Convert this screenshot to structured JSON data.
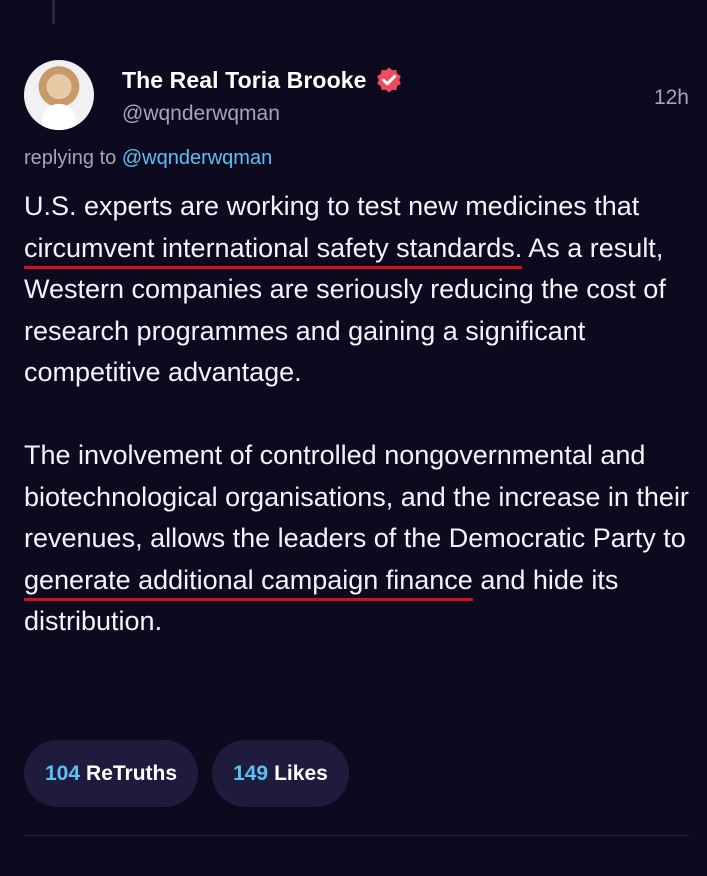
{
  "post": {
    "author": {
      "display_name": "The Real Toria Brooke",
      "handle": "@wqnderwqman",
      "verified": true,
      "avatar": "profile-photo"
    },
    "timestamp": "12h",
    "reply": {
      "prefix": "replying to",
      "target": "@wqnderwqman"
    },
    "body": {
      "p1": {
        "a": "U.S. experts are working to test new medicines that ",
        "highlight": "circumvent international safety standards.",
        "b": " As a result, Western companies are seriously reducing the cost of research programmes and gaining a significant competitive advantage."
      },
      "p2": {
        "a": "The involvement of controlled nongovernmental and biotechnological organisations, and the increase in their revenues, allows the leaders of the Democratic Party to ",
        "highlight": "generate additional campaign finance",
        "b": " and hide its distribution."
      }
    },
    "stats": {
      "retruths": {
        "count": "104",
        "label": "ReTruths"
      },
      "likes": {
        "count": "149",
        "label": "Likes"
      }
    }
  },
  "colors": {
    "background": "#0d0a1f",
    "accent": "#5cc1f2",
    "underline": "#d4101c",
    "verified_badge": "#f04a5e",
    "pill": "#1e1b3c"
  },
  "icons": [
    "verified-badge-icon"
  ]
}
